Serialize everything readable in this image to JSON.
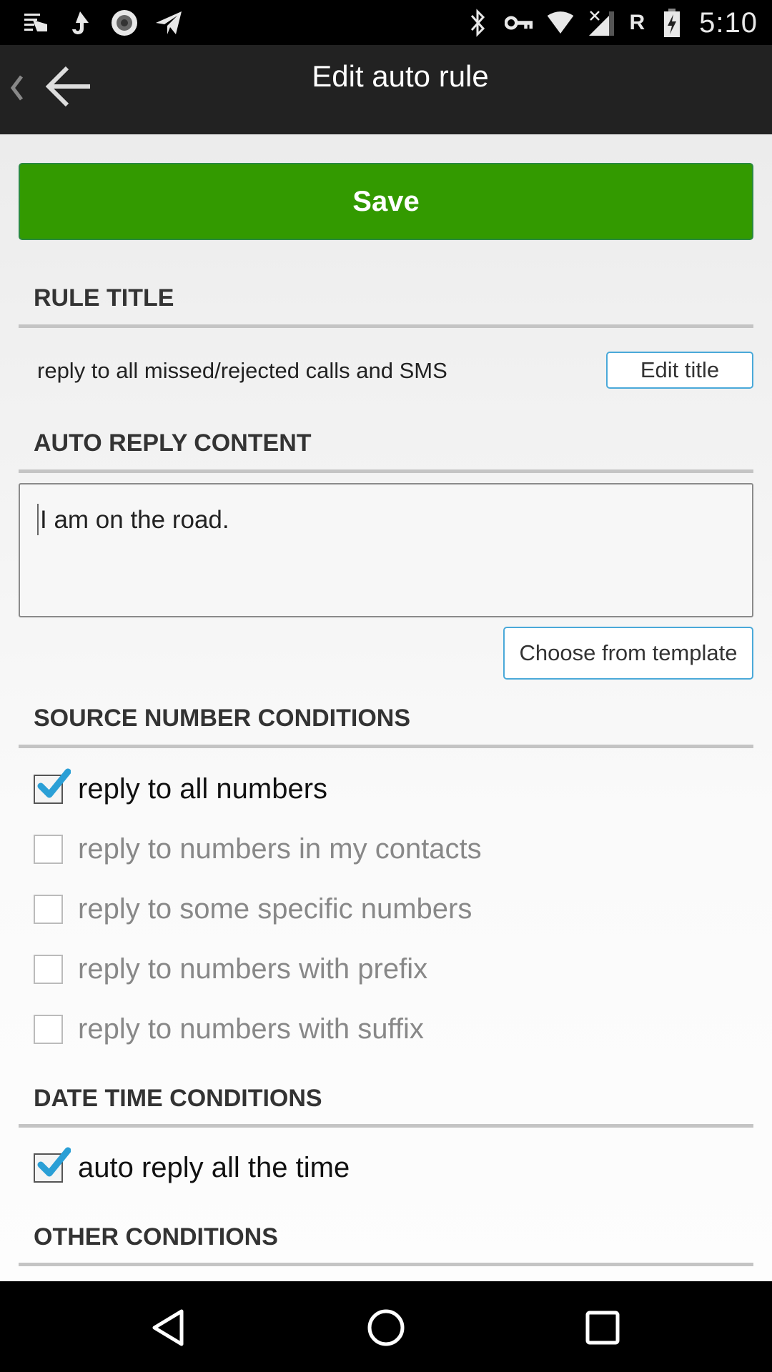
{
  "status_bar": {
    "left_icons": [
      "notification-stack-icon",
      "upload-app-icon",
      "record-icon",
      "send-icon"
    ],
    "right_icons": [
      "bluetooth-icon",
      "vpn-key-icon",
      "wifi-icon",
      "signal-no-service-icon",
      "battery-charging-icon"
    ],
    "roaming_label": "R",
    "time": "5:10"
  },
  "action_bar": {
    "title": "Edit auto rule"
  },
  "save_button": {
    "label": "Save",
    "color": "#339a00"
  },
  "rule_title": {
    "heading": "RULE TITLE",
    "value": "reply to all missed/rejected calls and SMS",
    "edit_button": "Edit title"
  },
  "auto_reply": {
    "heading": "AUTO REPLY CONTENT",
    "value": "I am on the road.",
    "template_button": "Choose from template"
  },
  "source_conditions": {
    "heading": "SOURCE NUMBER CONDITIONS",
    "options": [
      {
        "label": "reply to all numbers",
        "checked": true
      },
      {
        "label": "reply to numbers in my contacts",
        "checked": false
      },
      {
        "label": "reply to some specific numbers",
        "checked": false
      },
      {
        "label": "reply to numbers with prefix",
        "checked": false
      },
      {
        "label": "reply to numbers with suffix",
        "checked": false
      }
    ]
  },
  "datetime_conditions": {
    "heading": "DATE TIME CONDITIONS",
    "options": [
      {
        "label": "auto reply all the time",
        "checked": true
      }
    ]
  },
  "other_conditions": {
    "heading": "OTHER CONDITIONS"
  },
  "nav_bar": {
    "buttons": [
      "back",
      "home",
      "recents"
    ]
  },
  "colors": {
    "accent_check": "#2a9fd6",
    "outline_button_border": "#4aa9d9"
  }
}
